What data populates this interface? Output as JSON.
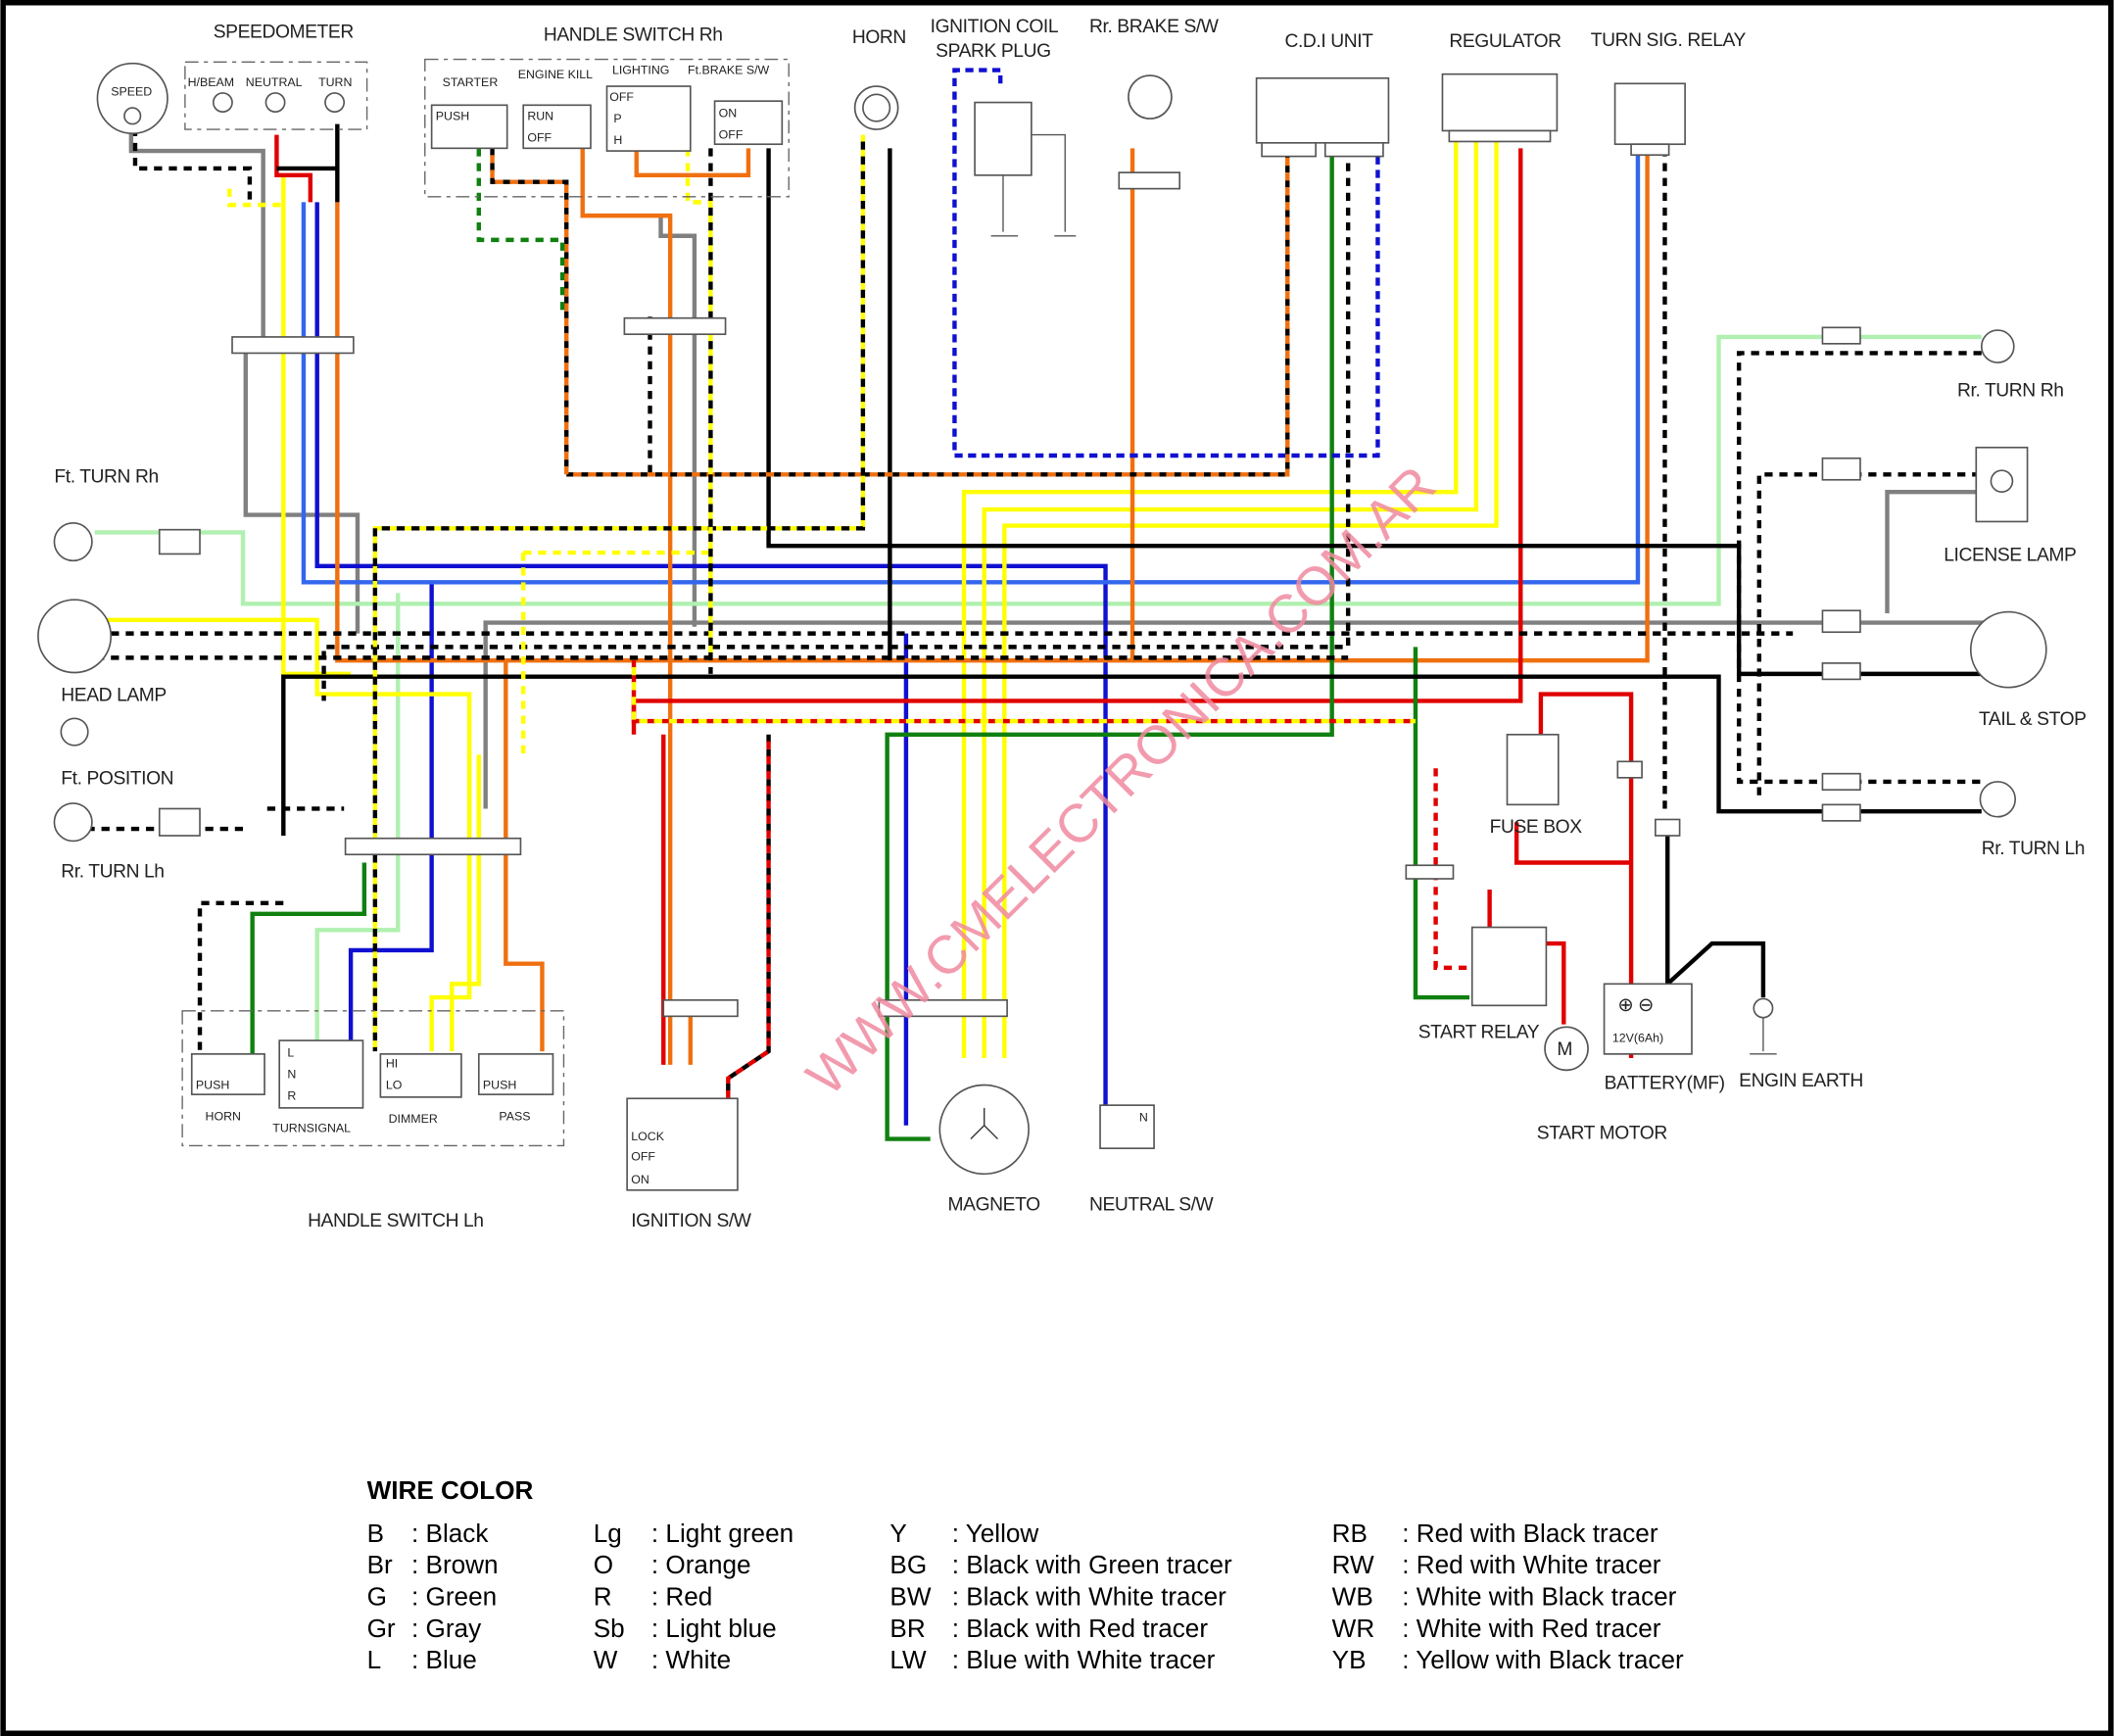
{
  "components": {
    "speedometer": "SPEEDOMETER",
    "speed": "SPEED",
    "hbeam": "H/BEAM",
    "neutral": "NEUTRAL",
    "turn": "TURN",
    "handle_switch_rh": "HANDLE SWITCH Rh",
    "starter": "STARTER",
    "engine_kill": "ENGINE KILL",
    "lighting": "LIGHTING",
    "ft_brake": "Ft.BRAKE S/W",
    "push": "PUSH",
    "run": "RUN",
    "off": "OFF",
    "on": "ON",
    "p": "P",
    "h": "H",
    "horn": "HORN",
    "ignition_coil": "IGNITION COIL",
    "spark_plug": "SPARK PLUG",
    "rr_brake": "Rr. BRAKE S/W",
    "cdi": "C.D.I UNIT",
    "regulator": "REGULATOR",
    "turn_relay": "TURN SIG. RELAY",
    "ft_turn_rh": "Ft. TURN Rh",
    "head_lamp": "HEAD LAMP",
    "ft_position": "Ft. POSITION",
    "rr_turn_lh_left": "Rr. TURN Lh",
    "rr_turn_rh": "Rr. TURN Rh",
    "license_lamp": "LICENSE LAMP",
    "tail_stop": "TAIL & STOP",
    "rr_turn_lh": "Rr. TURN Lh",
    "fuse_box": "FUSE BOX",
    "start_relay": "START RELAY",
    "start_motor": "START MOTOR",
    "battery": "BATTERY(MF)",
    "battery_spec": "12V(6Ah)",
    "engine_earth": "ENGIN EARTH",
    "magneto": "MAGNETO",
    "neutral_sw": "NEUTRAL S/W",
    "ignition_sw": "IGNITION S/W",
    "lock": "LOCK",
    "handle_switch_lh": "HANDLE SWITCH Lh",
    "sw_horn": "HORN",
    "sw_turnsignal": "TURNSIGNAL",
    "sw_dimmer": "DIMMER",
    "sw_pass": "PASS",
    "hi": "HI",
    "lo": "LO",
    "l": "L",
    "n": "N",
    "r": "R"
  },
  "watermark": "WWW.CMELECTRONICA.COM.AR",
  "legend": {
    "title": "WIRE COLOR",
    "columns": [
      [
        {
          "code": "B",
          "name": ": Black"
        },
        {
          "code": "Br",
          "name": ": Brown"
        },
        {
          "code": "G",
          "name": ": Green"
        },
        {
          "code": "Gr",
          "name": ": Gray"
        },
        {
          "code": "L",
          "name": ": Blue"
        }
      ],
      [
        {
          "code": "Lg",
          "name": ": Light green"
        },
        {
          "code": "O",
          "name": ": Orange"
        },
        {
          "code": "R",
          "name": ": Red"
        },
        {
          "code": "Sb",
          "name": ": Light blue"
        },
        {
          "code": "W",
          "name": ": White"
        }
      ],
      [
        {
          "code": "Y",
          "name": ": Yellow"
        },
        {
          "code": "BG",
          "name": ": Black with Green tracer"
        },
        {
          "code": "BW",
          "name": ": Black with White tracer"
        },
        {
          "code": "BR",
          "name": ": Black with Red tracer"
        },
        {
          "code": "LW",
          "name": ": Blue with White tracer"
        }
      ],
      [
        {
          "code": "RB",
          "name": ": Red with Black tracer"
        },
        {
          "code": "RW",
          "name": ": Red with White tracer"
        },
        {
          "code": "WB",
          "name": ": White with Black tracer"
        },
        {
          "code": "WR",
          "name": ": White with Red tracer"
        },
        {
          "code": "YB",
          "name": ": Yellow with Black tracer"
        }
      ]
    ]
  },
  "colors": {
    "black": "#000000",
    "yellow": "#ffff00",
    "red": "#e00000",
    "blue": "#1010d0",
    "lightblue": "#3366ee",
    "orange": "#f07010",
    "green": "#108010",
    "lightgreen": "#b0f0b0",
    "gray": "#808080",
    "watermark": "#f08aa0"
  }
}
